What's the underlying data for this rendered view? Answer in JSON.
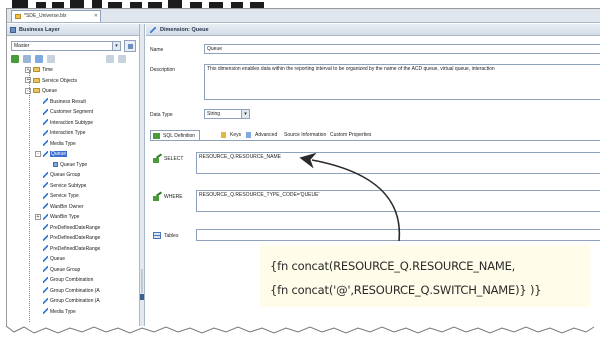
{
  "doc_tab": {
    "label": "*SDE_Universe.blx"
  },
  "left_panel": {
    "header": "Business Layer",
    "combo_value": "Master",
    "tree": [
      {
        "label": "Time",
        "indent": 0,
        "icon": "folder",
        "expander": "+"
      },
      {
        "label": "Service Objects",
        "indent": 0,
        "icon": "folder",
        "expander": "+"
      },
      {
        "label": "Queue",
        "indent": 0,
        "icon": "folder",
        "expander": "-"
      },
      {
        "label": "Business Result",
        "indent": 1,
        "icon": "dim"
      },
      {
        "label": "Customer Segment",
        "indent": 1,
        "icon": "dim"
      },
      {
        "label": "Interaction Subtype",
        "indent": 1,
        "icon": "dim"
      },
      {
        "label": "Interaction Type",
        "indent": 1,
        "icon": "dim"
      },
      {
        "label": "Media Type",
        "indent": 1,
        "icon": "dim"
      },
      {
        "label": "Queue",
        "indent": 1,
        "icon": "dim",
        "selected": true,
        "expander": "-"
      },
      {
        "label": "Queue Type",
        "indent": 2,
        "icon": "attr"
      },
      {
        "label": "Queue Group",
        "indent": 1,
        "icon": "dim"
      },
      {
        "label": "Service Subtype",
        "indent": 1,
        "icon": "dim"
      },
      {
        "label": "Service Type",
        "indent": 1,
        "icon": "dim"
      },
      {
        "label": "WanBin Owner",
        "indent": 1,
        "icon": "dim"
      },
      {
        "label": "WanBin Type",
        "indent": 1,
        "icon": "dim",
        "expander": "+"
      },
      {
        "label": "PreDefinedDateRange",
        "indent": 1,
        "icon": "dim"
      },
      {
        "label": "PreDefinedDateRange",
        "indent": 1,
        "icon": "dim"
      },
      {
        "label": "PreDefinedDateRange",
        "indent": 1,
        "icon": "dim"
      },
      {
        "label": "Queue",
        "indent": 1,
        "icon": "dim"
      },
      {
        "label": "Queue Group",
        "indent": 1,
        "icon": "dim"
      },
      {
        "label": "Group Combination",
        "indent": 1,
        "icon": "dim"
      },
      {
        "label": "Group Combination (A",
        "indent": 1,
        "icon": "dim"
      },
      {
        "label": "Group Combination (A",
        "indent": 1,
        "icon": "dim"
      },
      {
        "label": "Media Type",
        "indent": 1,
        "icon": "dim"
      }
    ]
  },
  "right_panel": {
    "header": "Dimension: Queue",
    "name_label": "Name",
    "name_value": "Queue",
    "description_label": "Description",
    "description_value": "This dimension enables data within the reporting interval to be organized by the name of the ACD queue, virtual queue, interaction",
    "data_type_label": "Data Type",
    "data_type_value": "String",
    "tabs": [
      "SQL Definition",
      "Keys",
      "Advanced",
      "Source Information",
      "Custom Properties"
    ],
    "select_label": "SELECT",
    "select_value": "RESOURCE_Q.RESOURCE_NAME",
    "where_label": "WHERE",
    "where_value": "RESOURCE_Q.RESOURCE_TYPE_CODE='QUEUE'",
    "tables_label": "Tables"
  },
  "callout": {
    "line1": "{fn concat(RESOURCE_Q.RESOURCE_NAME,",
    "line2": "{fn concat('@',RESOURCE_Q.SWITCH_NAME)} )}"
  },
  "title_fragment": "[+] ♦ r ■ ■ r 1 ♦ S"
}
